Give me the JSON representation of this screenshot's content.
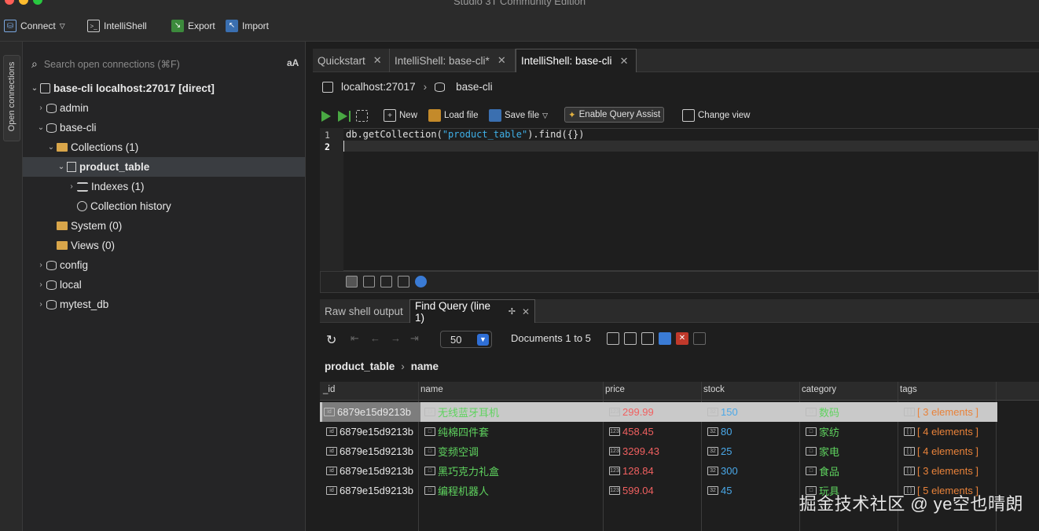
{
  "window": {
    "title": "Studio 3T Community Edition"
  },
  "toolbar": {
    "connect": "Connect",
    "intellishell": "IntelliShell",
    "export": "Export",
    "import": "Import"
  },
  "rail": {
    "label": "Open connections"
  },
  "tree": {
    "search_placeholder": "Search open connections (⌘F)",
    "aa": "aA",
    "items": [
      {
        "label": "base-cli localhost:27017 [direct]"
      },
      {
        "label": "admin"
      },
      {
        "label": "base-cli"
      },
      {
        "label": "Collections (1)"
      },
      {
        "label": "product_table"
      },
      {
        "label": "Indexes (1)"
      },
      {
        "label": "Collection history"
      },
      {
        "label": "System (0)"
      },
      {
        "label": "Views (0)"
      },
      {
        "label": "config"
      },
      {
        "label": "local"
      },
      {
        "label": "mytest_db"
      }
    ]
  },
  "tabs": [
    {
      "label": "Quickstart"
    },
    {
      "label": "IntelliShell: base-cli*"
    },
    {
      "label": "IntelliShell: base-cli"
    }
  ],
  "breadcrumb": {
    "host": "localhost:27017",
    "db": "base-cli"
  },
  "editor_toolbar": {
    "new": "New",
    "load": "Load file",
    "save": "Save file",
    "assist": "Enable Query Assist",
    "view": "Change view"
  },
  "editor": {
    "line1": "1",
    "line2": "2",
    "code_prefix": "db.getCollection(",
    "code_string": "\"product_table\"",
    "code_suffix": ").find({})"
  },
  "result_tabs": [
    {
      "label": "Raw shell output"
    },
    {
      "label": "Find Query (line 1)"
    }
  ],
  "result_toolbar": {
    "page_size": "50",
    "documents": "Documents 1 to 5"
  },
  "result_crumb": {
    "collection": "product_table",
    "field": "name"
  },
  "grid": {
    "columns": [
      "_id",
      "name",
      "price",
      "stock",
      "category",
      "tags"
    ],
    "rows": [
      {
        "id": "6879e15d9213b",
        "name": "无线蓝牙耳机",
        "price": "299.99",
        "stock": "150",
        "category": "数码",
        "tags": "[ 3 elements ]"
      },
      {
        "id": "6879e15d9213b",
        "name": "纯棉四件套",
        "price": "458.45",
        "stock": "80",
        "category": "家纺",
        "tags": "[ 4 elements ]"
      },
      {
        "id": "6879e15d9213b",
        "name": "变频空调",
        "price": "3299.43",
        "stock": "25",
        "category": "家电",
        "tags": "[ 4 elements ]"
      },
      {
        "id": "6879e15d9213b",
        "name": "黑巧克力礼盒",
        "price": "128.84",
        "stock": "300",
        "category": "食品",
        "tags": "[ 3 elements ]"
      },
      {
        "id": "6879e15d9213b",
        "name": "编程机器人",
        "price": "599.04",
        "stock": "45",
        "category": "玩具",
        "tags": "[ 5 elements ]"
      }
    ]
  },
  "watermark": "掘金技术社区 @ ye空也晴朗",
  "colors": {
    "accent": "#2f6fd6",
    "run": "#49a843",
    "string": "#3fb0e8",
    "price": "#f06060",
    "stock": "#4aa8e8",
    "text_green": "#5fd35f",
    "tags": "#e8823a"
  }
}
